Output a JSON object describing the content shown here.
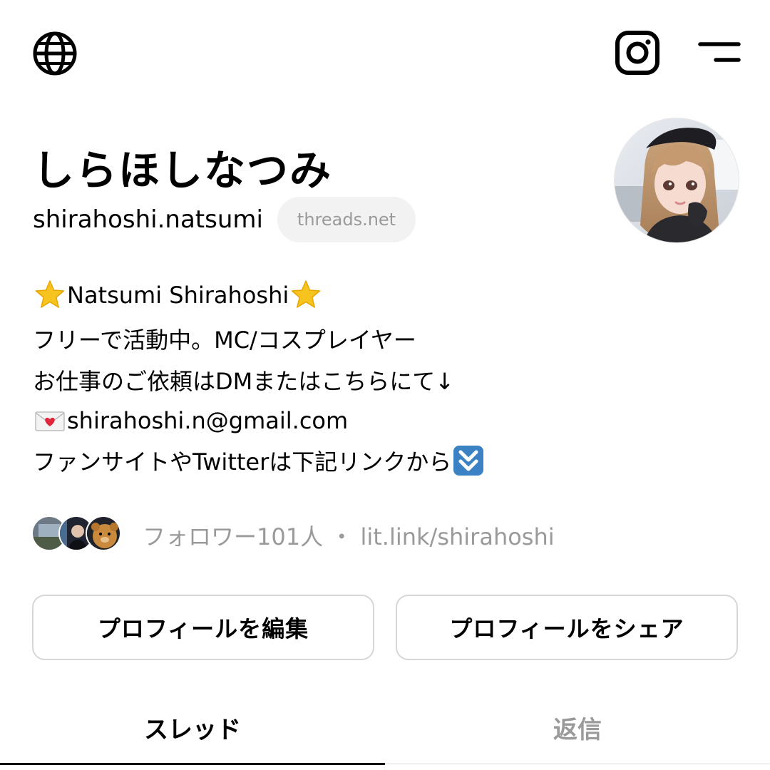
{
  "topbar": {
    "left_icon": "globe-icon",
    "right_icons": [
      "instagram-icon",
      "menu-icon"
    ]
  },
  "profile": {
    "display_name": "しらほしなつみ",
    "handle": "shirahoshi.natsumi",
    "domain_chip": "threads.net",
    "avatar": "profile-photo"
  },
  "bio": {
    "line1": "Natsumi Shirahoshi",
    "line2": "フリーで活動中。MC/コスプレイヤー",
    "line3": "お仕事のご依頼はDMまたはこちらにて↓",
    "line4": "shirahoshi.n@gmail.com",
    "line5": "ファンサイトやTwitterは下記リンクから",
    "icons": [
      "star-icon",
      "love-letter-icon",
      "double-down-arrow-icon"
    ]
  },
  "followers": {
    "count_text": "フォロワー101人",
    "separator": "・",
    "link": "lit.link/shirahoshi"
  },
  "actions": {
    "edit_label": "プロフィールを編集",
    "share_label": "プロフィールをシェア"
  },
  "tabs": {
    "threads_label": "スレッド",
    "replies_label": "返信",
    "active": "スレッド"
  },
  "colors": {
    "text": "#000000",
    "muted": "#9a9a9a",
    "border": "#d6d6d6",
    "chip_bg": "#f2f2f2",
    "star": "#f7c41f",
    "arrow_box": "#3b82c4"
  }
}
